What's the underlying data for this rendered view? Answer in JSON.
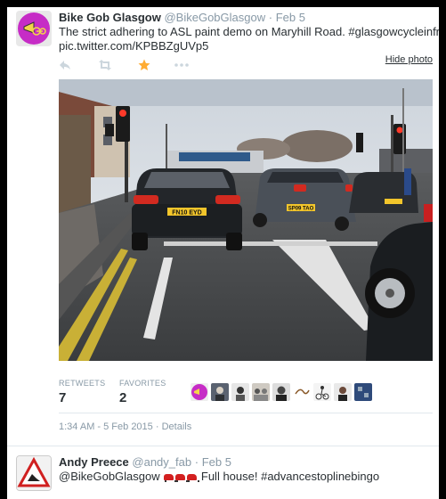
{
  "tweet": {
    "author_name": "Bike Gob Glasgow",
    "author_handle": "@BikeGobGlasgow",
    "separator": "·",
    "date": "Feb 5",
    "text_line1": "The strict adhering to ASL paint demo on Maryhill Road. #glasgowcycleinfraday",
    "text_line2": "pic.twitter.com/KPBBZgUVp5",
    "hide_photo_label": "Hide photo",
    "photo_plates": [
      "FN10 EYD",
      "SP09 TAO"
    ],
    "retweets_label": "RETWEETS",
    "retweets_count": "7",
    "favorites_label": "FAVORITES",
    "favorites_count": "2",
    "timestamp": "1:34 AM - 5 Feb 2015",
    "details_label": "Details",
    "meta_separator": "·"
  },
  "actions": {
    "reply_icon": "reply-icon",
    "retweet_icon": "retweet-icon",
    "favorite_icon": "star-icon",
    "more_icon": "more-icon",
    "favorite_color": "#ffac33"
  },
  "reply": {
    "author_name": "Andy Preece",
    "author_handle": "@andy_fab",
    "separator": "·",
    "date": "Feb 5",
    "mention": "@BikeGobGlasgow",
    "text": "Full house! #advancestoplinebingo"
  },
  "colors": {
    "muted": "#8899a6",
    "text": "#292f33",
    "avatar_bg": "#c62cc6"
  }
}
